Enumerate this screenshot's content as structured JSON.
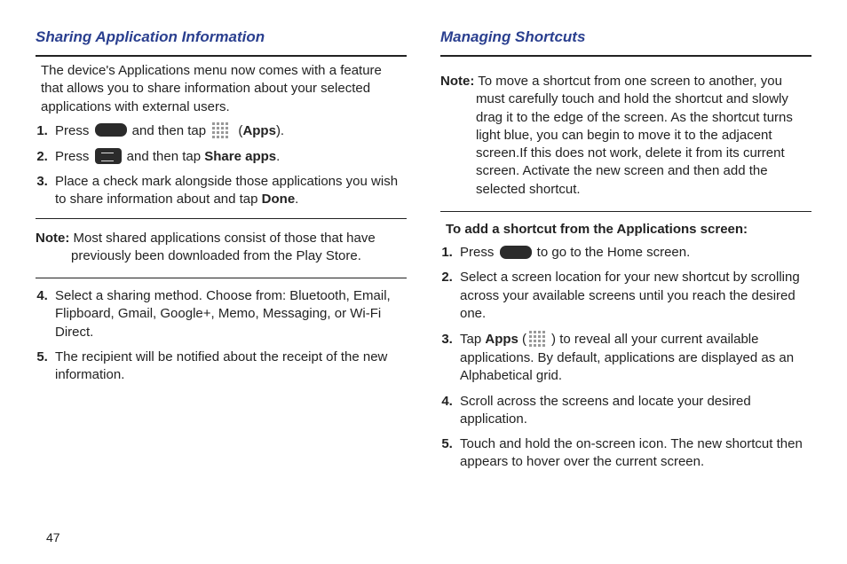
{
  "page_number": "47",
  "left": {
    "heading": "Sharing Application Information",
    "intro": "The device's Applications menu now comes with a feature that allows you to share information about your selected applications with external users.",
    "step1_a": "Press ",
    "step1_b": " and then tap ",
    "step1_c": " (",
    "step1_apps": "Apps",
    "step1_d": ").",
    "step2_a": "Press ",
    "step2_b": " and then tap ",
    "step2_share": "Share apps",
    "step2_c": ".",
    "step3_a": "Place a check mark alongside those applications you wish to share information about and tap ",
    "step3_done": "Done",
    "step3_b": ".",
    "note_label": "Note:",
    "note_body": " Most shared applications consist of those that have previously been downloaded from the Play Store.",
    "step4": "Select a sharing method. Choose from: Bluetooth, Email, Flipboard, Gmail, Google+, Memo, Messaging, or Wi-Fi Direct.",
    "step5": "The recipient will be notified about the receipt of the new information."
  },
  "right": {
    "heading": "Managing Shortcuts",
    "note_label": "Note:",
    "note_body": " To move a shortcut from one screen to another, you must carefully touch and hold the shortcut and slowly drag it to the edge of the screen. As the shortcut turns light blue, you can begin to move it to the adjacent screen.If this does not work, delete it from its current screen. Activate the new screen and then add the selected shortcut.",
    "subhead": "To add a shortcut from the Applications screen:",
    "step1_a": "Press ",
    "step1_b": " to go to the Home screen.",
    "step2": "Select a screen location for your new shortcut by scrolling across your available screens until you reach the desired one.",
    "step3_a": "Tap ",
    "step3_apps": "Apps",
    "step3_b": " (",
    "step3_c": ") to reveal all your current available applications. By default, applications are displayed as an Alphabetical grid.",
    "step4": "Scroll across the screens and locate your desired application.",
    "step5": "Touch and hold the on-screen icon. The new shortcut then appears to hover over the current screen."
  }
}
